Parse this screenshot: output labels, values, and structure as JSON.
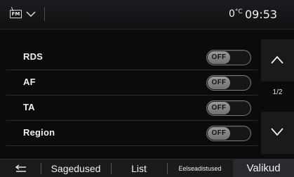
{
  "topbar": {
    "source_icon": "fm-radio-icon",
    "source_label": "FM",
    "menu_icon": "chevron-down-icon",
    "temperature_value": "0",
    "temperature_unit": "°C",
    "clock": "09:53"
  },
  "settings": [
    {
      "label": "RDS",
      "toggle": "OFF"
    },
    {
      "label": "AF",
      "toggle": "OFF"
    },
    {
      "label": "TA",
      "toggle": "OFF"
    },
    {
      "label": "Region",
      "toggle": "OFF"
    }
  ],
  "scroll": {
    "up_icon": "chevron-up-icon",
    "down_icon": "chevron-down-icon",
    "page_indicator": "1/2"
  },
  "bottombar": {
    "back_icon": "back-arrow-icon",
    "tabs": [
      {
        "label": "Sagedused"
      },
      {
        "label": "List"
      },
      {
        "label": "Eelseadistused"
      },
      {
        "label": "Valikud"
      }
    ]
  },
  "colors": {
    "background": "#0b0b0d",
    "toggle_knob": "#8a8a8a",
    "text": "#f0f0f0",
    "active_tab": "#2a2a2e"
  }
}
